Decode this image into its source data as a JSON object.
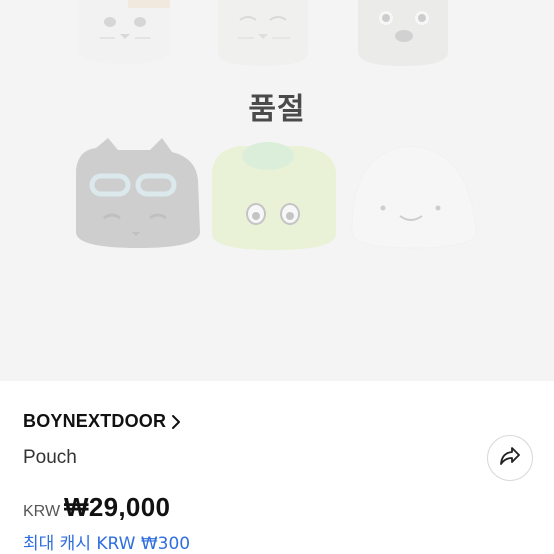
{
  "product_image": {
    "soldout_label": "품절"
  },
  "product": {
    "brand": "BOYNEXTDOOR",
    "name": "Pouch",
    "currency": "KRW",
    "price": "₩29,000",
    "max_cash": "최대 캐시 KRW ₩300"
  },
  "colors": {
    "accent_blue": "#2f6ee0",
    "image_background": "#f2f2f2",
    "text_primary": "#111111"
  },
  "icons": {
    "brand_link": "chevron-right-icon",
    "share": "share-arrow-icon"
  }
}
